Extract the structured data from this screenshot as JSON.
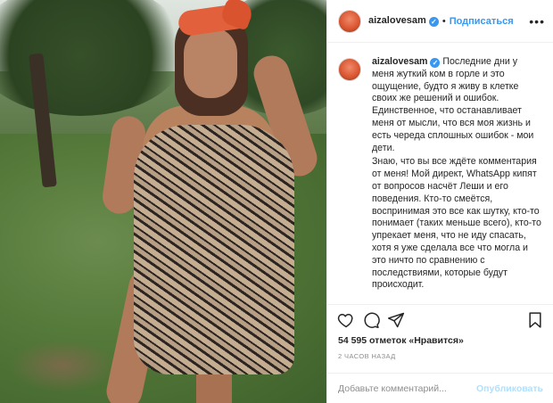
{
  "header": {
    "username": "aizalovesam",
    "verified_mark": "✓",
    "separator": "•",
    "follow_label": "Подписаться",
    "more_label": "•••"
  },
  "caption": {
    "username": "aizalovesam",
    "verified_mark": "✓",
    "paragraph_1": "Последние дни у меня жуткий ком в горле и это ощущение, будто я живу в клетке своих же решений и ошибок. Единственное, что останавливает меня от мысли, что вся моя жизнь и есть череда сплошных ошибок - мои дети.",
    "paragraph_2": "Знаю, что вы все ждёте комментария от меня! Мой директ, WhatsApp кипят от вопросов насчёт Леши и его поведения. Кто-то смеётся, воспринимая это все как шутку, кто-то понимает (таких меньше всего), кто-то упрекает меня, что не иду спасать, хотя я уже сделала все что могла и это ничто по сравнению с последствиями, которые будут происходит."
  },
  "actions": {
    "like_icon": "heart-icon",
    "comment_icon": "comment-icon",
    "share_icon": "share-icon",
    "save_icon": "bookmark-icon"
  },
  "likes": {
    "text": "54 595 отметок «Нравится»"
  },
  "timestamp": "2 ЧАСОВ НАЗАД",
  "comment": {
    "placeholder": "Добавьте комментарий...",
    "publish_label": "Опубликовать"
  },
  "colors": {
    "accent": "#3897f0",
    "publish_disabled": "#b2dffc",
    "muted": "#8e8e8e",
    "text": "#262626",
    "border": "#efefef"
  }
}
